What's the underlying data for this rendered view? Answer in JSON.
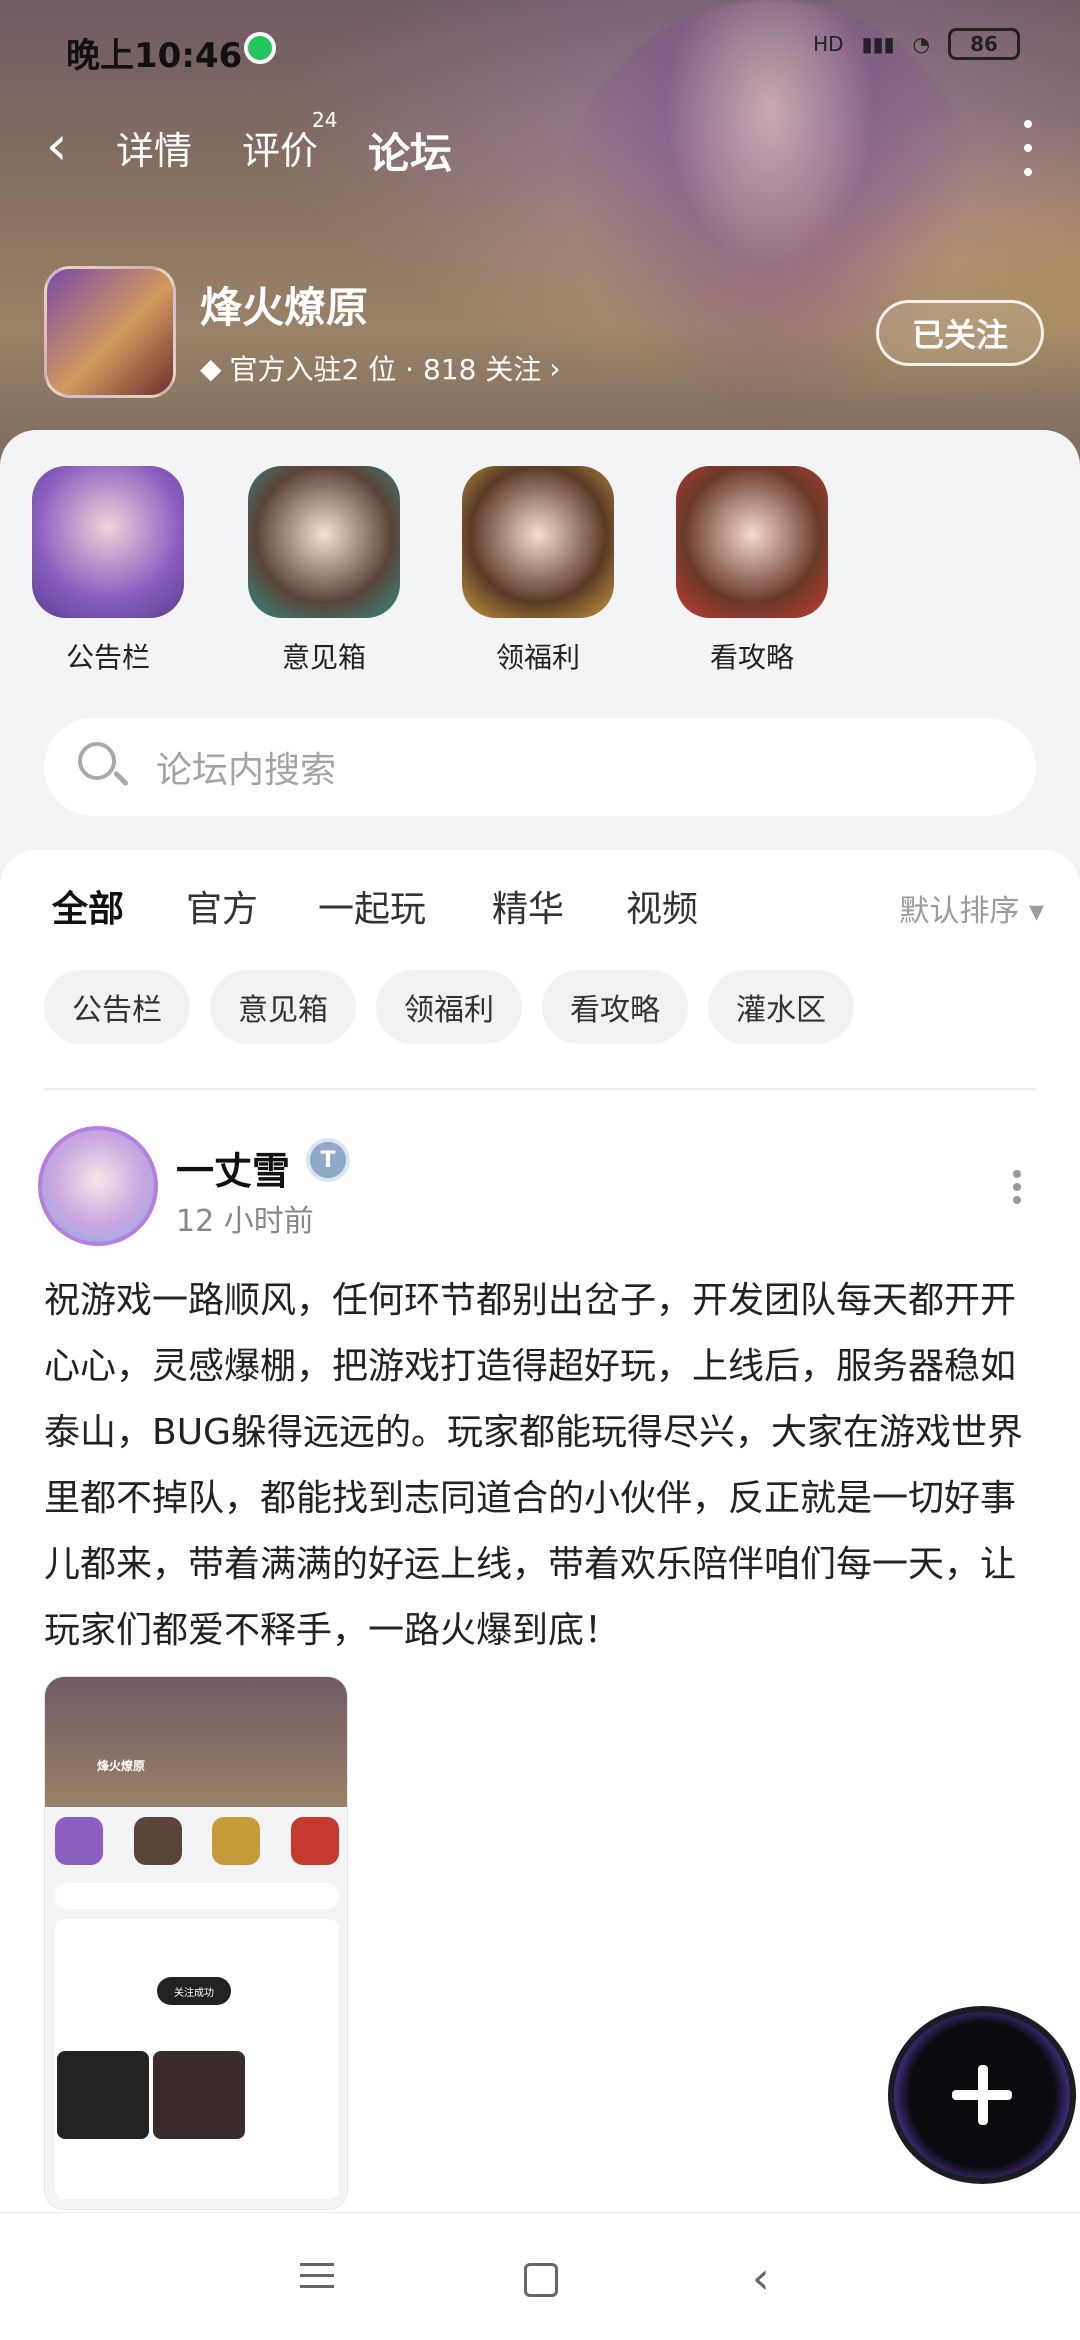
{
  "status": {
    "time": "晚上10:46",
    "network_label": "HD",
    "battery": "86"
  },
  "nav": {
    "back_icon": "back-icon",
    "tabs": [
      {
        "label": "详情"
      },
      {
        "label": "评价",
        "badge": "24"
      },
      {
        "label": "论坛"
      }
    ],
    "more_icon": "more-vertical-icon"
  },
  "forum": {
    "title": "烽火燎原",
    "meta": "官方入驻2 位 · 818 关注",
    "follow_label": "已关注"
  },
  "quick_links": [
    {
      "label": "公告栏"
    },
    {
      "label": "意见箱"
    },
    {
      "label": "领福利"
    },
    {
      "label": "看攻略"
    }
  ],
  "search": {
    "placeholder": "论坛内搜索"
  },
  "filters": {
    "tabs": [
      {
        "label": "全部"
      },
      {
        "label": "官方"
      },
      {
        "label": "一起玩"
      },
      {
        "label": "精华"
      },
      {
        "label": "视频"
      }
    ],
    "sort_label": "默认排序",
    "chips": [
      "公告栏",
      "意见箱",
      "领福利",
      "看攻略",
      "灌水区"
    ]
  },
  "post": {
    "author": "一丈雪",
    "badge": "T",
    "time": "12 小时前",
    "text": "祝游戏一路顺风，任何环节都别出岔子，开发团队每天都开开心心，灵感爆棚，把游戏打造得超好玩，上线后，服务器稳如泰山，BUG躲得远远的。玩家都能玩得尽兴，大家在游戏世界里都不掉队，都能找到志同道合的小伙伴，反正就是一切好事儿都来，带着满满的好运上线，带着欢乐陪伴咱们每一天，让玩家们都爱不释手，一路火爆到底！",
    "image_title": "烽火燎原",
    "image_toast": "关注成功"
  },
  "colors": {
    "accent": "#19c2a8"
  }
}
